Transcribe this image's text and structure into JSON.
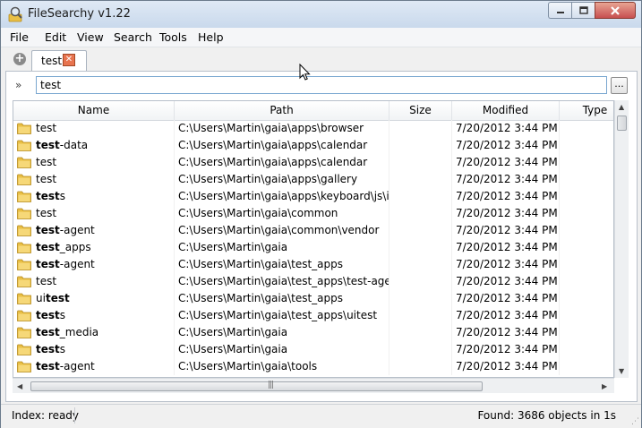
{
  "window": {
    "title": "FileSearchy v1.22"
  },
  "menu": [
    "File",
    "Edit",
    "View",
    "Search",
    "Tools",
    "Help"
  ],
  "tabs": [
    {
      "label": "test"
    }
  ],
  "search": {
    "value": "test",
    "chevron": "»",
    "browse_label": "..."
  },
  "columns": [
    "Name",
    "Path",
    "Size",
    "Modified",
    "Type"
  ],
  "rows": [
    {
      "name_pre": "",
      "name_bold": "",
      "name_post": "test",
      "path": "C:\\Users\\Martin\\gaia\\apps\\browser",
      "size": "",
      "modified": "7/20/2012 3:44 PM",
      "type": ""
    },
    {
      "name_pre": "",
      "name_bold": "test",
      "name_post": "-data",
      "path": "C:\\Users\\Martin\\gaia\\apps\\calendar",
      "size": "",
      "modified": "7/20/2012 3:44 PM",
      "type": ""
    },
    {
      "name_pre": "",
      "name_bold": "",
      "name_post": "test",
      "path": "C:\\Users\\Martin\\gaia\\apps\\calendar",
      "size": "",
      "modified": "7/20/2012 3:44 PM",
      "type": ""
    },
    {
      "name_pre": "",
      "name_bold": "",
      "name_post": "test",
      "path": "C:\\Users\\Martin\\gaia\\apps\\gallery",
      "size": "",
      "modified": "7/20/2012 3:44 PM",
      "type": ""
    },
    {
      "name_pre": "",
      "name_bold": "test",
      "name_post": "s",
      "path": "C:\\Users\\Martin\\gaia\\apps\\keyboard\\js\\i...",
      "size": "",
      "modified": "7/20/2012 3:44 PM",
      "type": ""
    },
    {
      "name_pre": "",
      "name_bold": "",
      "name_post": "test",
      "path": "C:\\Users\\Martin\\gaia\\common",
      "size": "",
      "modified": "7/20/2012 3:44 PM",
      "type": ""
    },
    {
      "name_pre": "",
      "name_bold": "test",
      "name_post": "-agent",
      "path": "C:\\Users\\Martin\\gaia\\common\\vendor",
      "size": "",
      "modified": "7/20/2012 3:44 PM",
      "type": ""
    },
    {
      "name_pre": "",
      "name_bold": "test",
      "name_post": "_apps",
      "path": "C:\\Users\\Martin\\gaia",
      "size": "",
      "modified": "7/20/2012 3:44 PM",
      "type": ""
    },
    {
      "name_pre": "",
      "name_bold": "test",
      "name_post": "-agent",
      "path": "C:\\Users\\Martin\\gaia\\test_apps",
      "size": "",
      "modified": "7/20/2012 3:44 PM",
      "type": ""
    },
    {
      "name_pre": "",
      "name_bold": "",
      "name_post": "test",
      "path": "C:\\Users\\Martin\\gaia\\test_apps\\test-agent",
      "size": "",
      "modified": "7/20/2012 3:44 PM",
      "type": ""
    },
    {
      "name_pre": "ui",
      "name_bold": "test",
      "name_post": "",
      "path": "C:\\Users\\Martin\\gaia\\test_apps",
      "size": "",
      "modified": "7/20/2012 3:44 PM",
      "type": ""
    },
    {
      "name_pre": "",
      "name_bold": "test",
      "name_post": "s",
      "path": "C:\\Users\\Martin\\gaia\\test_apps\\uitest",
      "size": "",
      "modified": "7/20/2012 3:44 PM",
      "type": ""
    },
    {
      "name_pre": "",
      "name_bold": "test",
      "name_post": "_media",
      "path": "C:\\Users\\Martin\\gaia",
      "size": "",
      "modified": "7/20/2012 3:44 PM",
      "type": ""
    },
    {
      "name_pre": "",
      "name_bold": "test",
      "name_post": "s",
      "path": "C:\\Users\\Martin\\gaia",
      "size": "",
      "modified": "7/20/2012 3:44 PM",
      "type": ""
    },
    {
      "name_pre": "",
      "name_bold": "test",
      "name_post": "-agent",
      "path": "C:\\Users\\Martin\\gaia\\tools",
      "size": "",
      "modified": "7/20/2012 3:44 PM",
      "type": ""
    }
  ],
  "status": {
    "left": "Index: ready",
    "right": "Found: 3686 objects in 1s"
  },
  "icons": {
    "app": "magnifier-folder-icon",
    "row": "folder-icon",
    "add_tab": "plus-circle-icon",
    "tab_close": "close-icon"
  },
  "colors": {
    "folder": "#e9bf45",
    "tab_close": "#e8744f",
    "input_border": "#7aa7d0"
  }
}
